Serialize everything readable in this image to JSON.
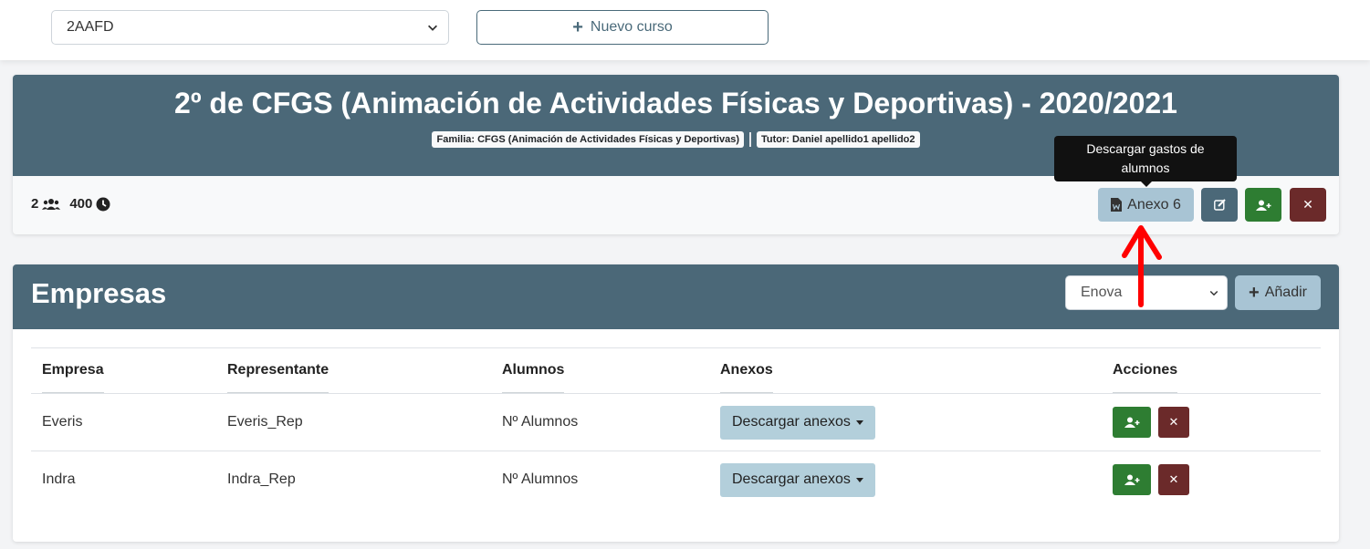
{
  "topbar": {
    "course_select": {
      "value": "2AAFD"
    },
    "new_course_label": "Nuevo curso"
  },
  "course_card": {
    "title": "2º de CFGS (Animación de Actividades Físicas y Deportivas) - 2020/2021",
    "family_badge": "Familia: CFGS (Animación de Actividades Físicas y Deportivas)",
    "tutor_badge": "Tutor: Daniel apellido1 apellido2",
    "students_count": "2",
    "hours": "400",
    "anexo6_label": "Anexo 6",
    "tooltip_line1": "Descargar gastos de",
    "tooltip_line2": "alumnos"
  },
  "companies_card": {
    "title": "Empresas",
    "company_select": {
      "value": "Enova"
    },
    "add_label": "Añadir",
    "columns": [
      "Empresa",
      "Representante",
      "Alumnos",
      "Anexos",
      "Acciones"
    ],
    "rows": [
      {
        "empresa": "Everis",
        "representante": "Everis_Rep",
        "alumnos": "Nº Alumnos",
        "anexos": "Descargar anexos"
      },
      {
        "empresa": "Indra",
        "representante": "Indra_Rep",
        "alumnos": "Nº Alumnos",
        "anexos": "Descargar anexos"
      }
    ]
  },
  "colors": {
    "header_bg": "#4b6878",
    "light_btn": "#a8c4d4",
    "success": "#2e7d32",
    "danger": "#6b2a2a",
    "annotation_arrow": "#ff0000"
  }
}
